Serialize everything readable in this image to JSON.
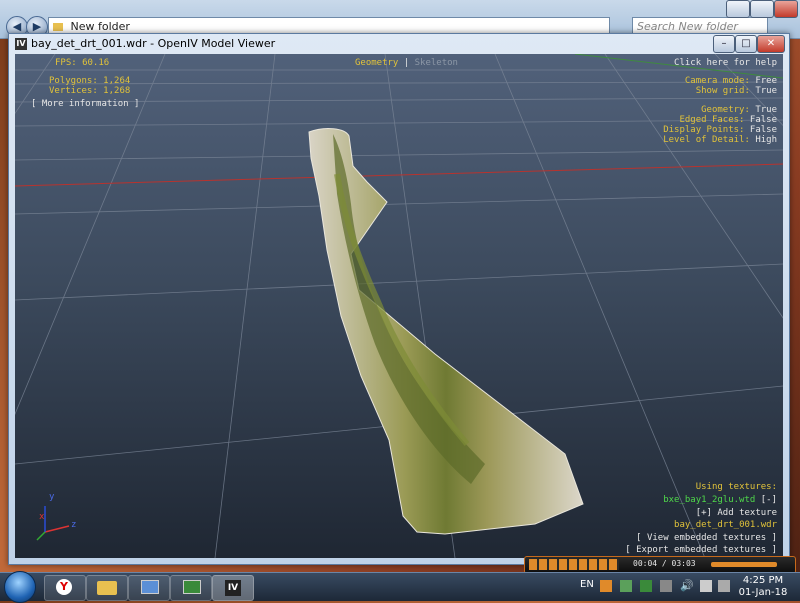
{
  "explorer": {
    "address": "New folder",
    "search_placeholder": "Search New folder",
    "back_glyph": "◀",
    "forward_glyph": "▶"
  },
  "viewer": {
    "title": "bay_det_drt_001.wdr - OpenIV Model Viewer",
    "app_icon": "IV",
    "hud": {
      "fps": "FPS: 60.16",
      "tabs": [
        "Geometry",
        "|",
        "Skeleton"
      ],
      "help": "Click here for help",
      "polygons": "Polygons: 1,264",
      "vertices": "Vertices: 1,268",
      "more_info": "[ More information ]",
      "camera_mode_label": "Camera mode:",
      "camera_mode_value": "Free",
      "show_grid_label": "Show grid:",
      "show_grid_value": "True",
      "geometry_label": "Geometry:",
      "geometry_value": "True",
      "edged_faces_label": "Edged Faces:",
      "edged_faces_value": "False",
      "display_points_label": "Display Points:",
      "display_points_value": "False",
      "lod_label": "Level of Detail:",
      "lod_value": "High",
      "using_textures": "Using textures:",
      "texture_file": "bxe_bay1_2glu.wtd",
      "texture_remove": "[-]",
      "add_texture": "[+] Add texture",
      "model_file": "bay_det_drt_001.wdr",
      "view_embedded": "[ View embedded textures ]",
      "export_embedded": "[ Export embedded textures ]",
      "axis_x": "x",
      "axis_y": "y",
      "axis_z": "z"
    }
  },
  "media": {
    "time": "00:04 / 03:03"
  },
  "taskbar": {
    "language": "EN",
    "time": "4:25 PM",
    "date": "01-Jan-18",
    "items": [
      "yandex-browser",
      "file-explorer",
      "system-app",
      "media-app",
      "openiv"
    ]
  },
  "colors": {
    "hud_yellow": "#e0c23a",
    "hud_green": "#4fd84a",
    "hud_white": "#e6e6e6",
    "grid_red": "#b8332e"
  }
}
